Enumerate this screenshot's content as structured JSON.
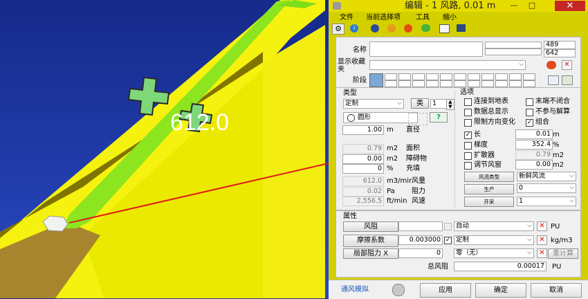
{
  "scene": {
    "value_label": "612.0"
  },
  "window": {
    "title": "编辑 - 1 风路, 0.01 m",
    "close": "✕",
    "minimize": "—",
    "maximize": "□"
  },
  "menu": [
    "文件",
    "当前选择项",
    "工具",
    "缩小"
  ],
  "toolbar_icons": [
    "gear-icon",
    "info-icon",
    "globe-icon",
    "fan-icon",
    "fire-icon",
    "comment-icon",
    "book-icon",
    "chart-icon"
  ],
  "top": {
    "name_label": "名称",
    "name_value": "",
    "id1": "489",
    "id2": "642",
    "folder_label": "显示收藏夹",
    "folder_value": "",
    "stage_label": "阶段"
  },
  "type": {
    "header": "类型",
    "type_value": "定制",
    "class_label": "类",
    "class_value": "1",
    "shape_value": "圆形",
    "help": "?",
    "rows": [
      {
        "value": "1.00",
        "unit": "m",
        "label": "直径",
        "readonly": false
      },
      {
        "value": "0.79",
        "unit": "m2",
        "label": "面积",
        "readonly": true
      },
      {
        "value": "0.00",
        "unit": "m2",
        "label": "障碍物",
        "readonly": false
      },
      {
        "value": "0",
        "unit": "%",
        "label": "充填",
        "readonly": false
      },
      {
        "value": "612.0",
        "unit": "m3/mir",
        "label": "风量",
        "readonly": true
      },
      {
        "value": "0.02",
        "unit": "Pa",
        "label": "阻力",
        "readonly": true
      },
      {
        "value": "2,556.5",
        "unit": "ft/min",
        "label": "风速",
        "readonly": true
      }
    ]
  },
  "options": {
    "header": "选项",
    "checks_left": [
      {
        "label": "连接到地表",
        "checked": false
      },
      {
        "label": "数据总显示",
        "checked": false
      },
      {
        "label": "限制方向变化",
        "checked": false
      }
    ],
    "checks_right": [
      {
        "label": "末端不闭合",
        "checked": false
      },
      {
        "label": "不参与解算",
        "checked": false
      },
      {
        "label": "组合",
        "checked": true
      }
    ],
    "props": [
      {
        "label": "长",
        "checked": true,
        "value": "0.01",
        "unit": "m",
        "readonly": false
      },
      {
        "label": "梯度",
        "checked": false,
        "value": "352.4",
        "unit": "%",
        "readonly": false
      },
      {
        "label": "扩散器",
        "checked": false,
        "value": "0.79",
        "unit": "m2",
        "readonly": true
      },
      {
        "label": "调节风窗",
        "checked": false,
        "value": "0.00",
        "unit": "m2",
        "readonly": false
      }
    ],
    "dropdowns": [
      {
        "button": "风流类型",
        "value": "新鲜风流"
      },
      {
        "button": "生产",
        "value": "0"
      },
      {
        "button": "开采",
        "value": "1"
      }
    ]
  },
  "attributes": {
    "header": "属性",
    "rows": [
      {
        "button": "风阻",
        "value": "",
        "select": "自动",
        "unit": "PU",
        "checked": false
      },
      {
        "button": "摩擦系数",
        "value": "0.003000",
        "select": "定制",
        "unit": "kg/m3",
        "checked": true
      },
      {
        "button": "局部阻力 X",
        "value": "0",
        "select": "零（无）",
        "unit": "重计算",
        "checked": false
      }
    ],
    "total_label": "总风阻",
    "total_value": "0.00017",
    "total_unit": "PU"
  },
  "bottom": {
    "sim_label": "通风模拟",
    "apply": "应用",
    "ok": "确定",
    "cancel": "取消"
  }
}
